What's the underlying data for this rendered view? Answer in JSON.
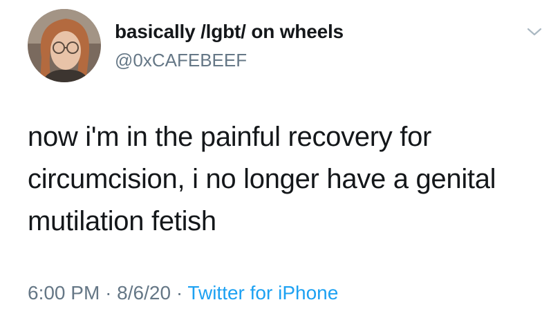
{
  "tweet": {
    "author": {
      "display_name": "basically /lgbt/ on wheels",
      "handle": "@0xCAFEBEEF",
      "avatar_icon": "user-avatar"
    },
    "menu_icon": "chevron-down-icon",
    "text": "now i'm in the painful recovery for\ncircumcision, i no longer have a genital\nmutilation fetish",
    "meta": {
      "time": "6:00 PM",
      "separator": "·",
      "date": "8/6/20",
      "source": "Twitter for iPhone"
    }
  },
  "colors": {
    "text_primary": "#14171a",
    "text_secondary": "#657786",
    "link": "#1da1f2"
  }
}
